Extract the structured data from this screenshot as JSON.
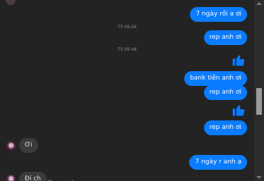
{
  "messages": {
    "out_1": "7 ngày rồi a ơi",
    "ts_1": "T5 09:26",
    "out_2": "rep anh ơi",
    "ts_2": "T5 09:48",
    "out_3": "bank tiền anh ơi",
    "out_4": "rep anh ơi",
    "out_5": "rep anh ơi",
    "in_1": "Ơi",
    "out_6": "7 ngày r anh ạ",
    "in_2": "Đi ch"
  },
  "colors": {
    "background": "#232323",
    "outgoing_bubble": "#0a7cff",
    "incoming_bubble": "#3a3b3c",
    "like_icon": "#0a7cff"
  },
  "icons": [
    "like-icon",
    "emoji-react-icon",
    "reply-icon",
    "more-options-icon"
  ]
}
